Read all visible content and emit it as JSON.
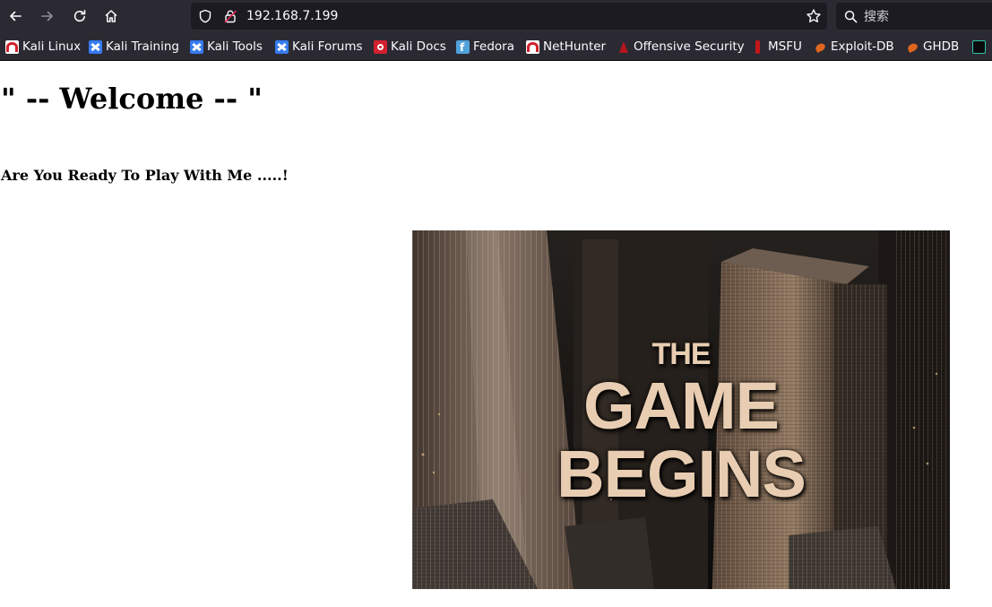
{
  "browser": {
    "url": "192.168.7.199",
    "search_placeholder": "搜索",
    "bookmarks": [
      {
        "label": "Kali Linux",
        "icon": "kali-dragon-icon"
      },
      {
        "label": "Kali Training",
        "icon": "kali-training-icon"
      },
      {
        "label": "Kali Tools",
        "icon": "kali-tools-icon"
      },
      {
        "label": "Kali Forums",
        "icon": "kali-forums-icon"
      },
      {
        "label": "Kali Docs",
        "icon": "kali-docs-icon"
      },
      {
        "label": "Fedora",
        "icon": "fedora-icon"
      },
      {
        "label": "NetHunter",
        "icon": "nethunter-icon"
      },
      {
        "label": "Offensive Security",
        "icon": "offsec-icon"
      },
      {
        "label": "MSFU",
        "icon": "msfu-icon"
      },
      {
        "label": "Exploit-DB",
        "icon": "exploit-db-icon"
      },
      {
        "label": "GHDB",
        "icon": "ghdb-icon"
      }
    ]
  },
  "page": {
    "heading": "\" -- Welcome -- \"",
    "subheading": "Are You Ready To Play With Me .....!",
    "hero_image": {
      "line1": "THE",
      "line2": "GAME",
      "line3": "BEGINS"
    }
  },
  "colors": {
    "chrome_bg": "#2b2a33",
    "urlbar_bg": "#1c1b22",
    "kali_red": "#d2202d",
    "kali_blue": "#367bf0"
  }
}
